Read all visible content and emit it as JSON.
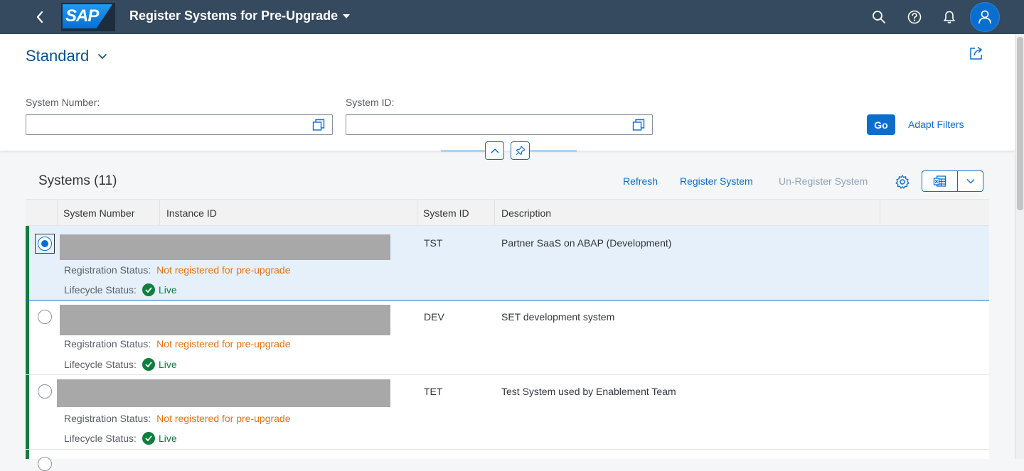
{
  "shell": {
    "logo_text": "SAP",
    "title": "Register Systems for Pre-Upgrade",
    "icons": [
      "back-icon",
      "search-icon",
      "help-icon",
      "bell-icon",
      "user-icon"
    ],
    "brand_color": "#354a5f"
  },
  "header": {
    "variant": "Standard",
    "filters": [
      {
        "label": "System Number:",
        "value": "",
        "placeholder": ""
      },
      {
        "label": "System ID:",
        "value": "",
        "placeholder": ""
      }
    ],
    "go_label": "Go",
    "adapt_label": "Adapt Filters"
  },
  "table": {
    "title": "Systems (11)",
    "toolbar": {
      "refresh": "Refresh",
      "register": "Register System",
      "unregister": "Un-Register System"
    },
    "columns": [
      "System Number",
      "Instance ID",
      "System ID",
      "Description"
    ],
    "status_labels": {
      "registration": "Registration Status:",
      "lifecycle": "Lifecycle Status:"
    },
    "rows": [
      {
        "system_id": "TST",
        "description": "Partner SaaS on ABAP (Development)",
        "registration": "Not registered for pre-upgrade",
        "lifecycle": "Live",
        "selected": true
      },
      {
        "system_id": "DEV",
        "description": "SET development system",
        "registration": "Not registered for pre-upgrade",
        "lifecycle": "Live",
        "selected": false
      },
      {
        "system_id": "TET",
        "description": "Test System used by Enablement Team",
        "registration": "Not registered for pre-upgrade",
        "lifecycle": "Live",
        "selected": false
      }
    ]
  },
  "colors": {
    "accent": "#0a6ed1",
    "negative": "#e9730c",
    "positive": "#107e3e"
  }
}
